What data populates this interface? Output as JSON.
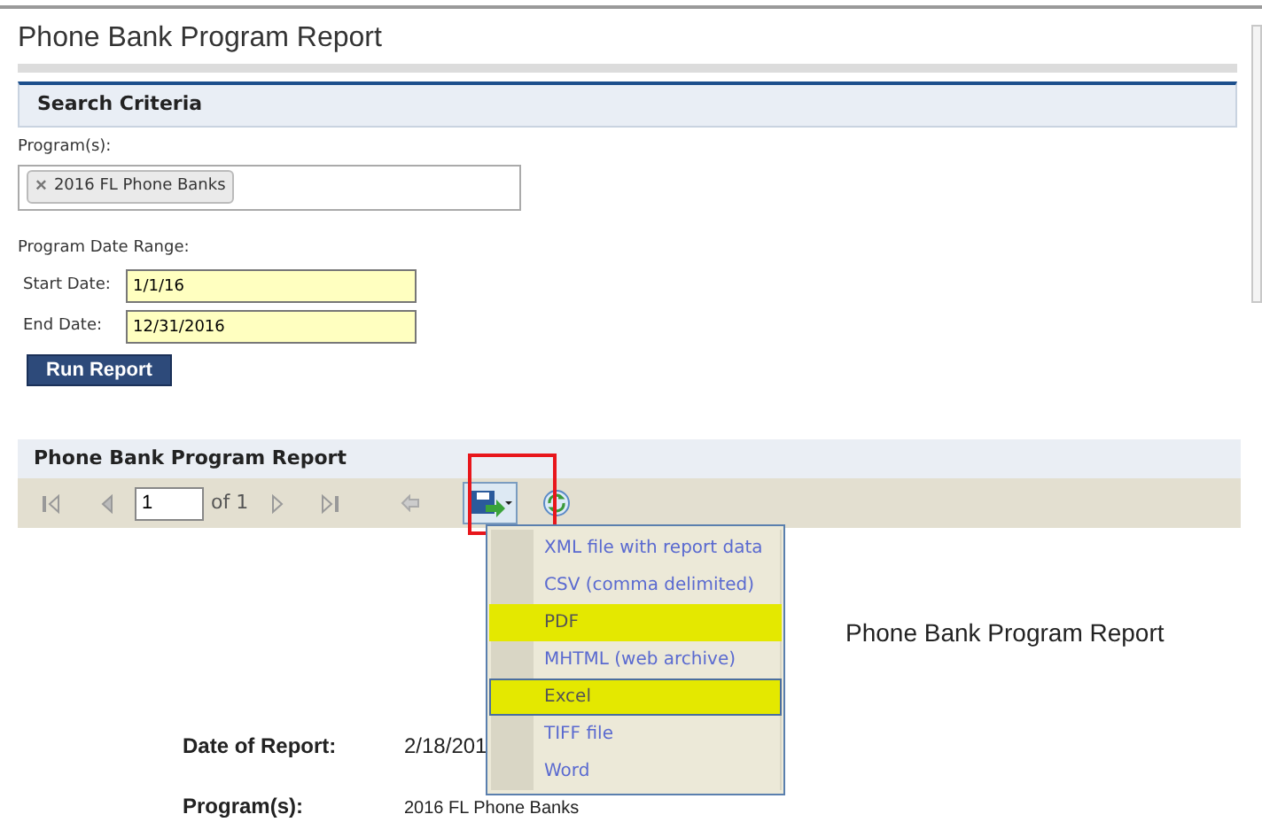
{
  "page_title": "Phone Bank Program Report",
  "search_criteria": {
    "title": "Search Criteria",
    "programs_label": "Program(s):",
    "programs": [
      {
        "label": "2016 FL Phone Banks",
        "remove": "×"
      }
    ],
    "date_range_label": "Program Date Range:",
    "start_date": {
      "label": "Start Date:",
      "value": "1/1/16"
    },
    "end_date": {
      "label": "End Date:",
      "value": "12/31/2016"
    },
    "run_button": "Run Report"
  },
  "report_viewer": {
    "title": "Phone Bank Program Report",
    "page_number": "1",
    "page_count": "of 1",
    "export_highlighted": true,
    "export_menu": [
      {
        "label": "XML file with report data",
        "highlighted": false,
        "selected": false
      },
      {
        "label": "CSV (comma delimited)",
        "highlighted": false,
        "selected": false
      },
      {
        "label": "PDF",
        "highlighted": true,
        "selected": false
      },
      {
        "label": "MHTML (web archive)",
        "highlighted": false,
        "selected": false
      },
      {
        "label": "Excel",
        "highlighted": true,
        "selected": true
      },
      {
        "label": "TIFF file",
        "highlighted": false,
        "selected": false
      },
      {
        "label": "Word",
        "highlighted": false,
        "selected": false
      }
    ]
  },
  "report": {
    "heading": "Phone Bank Program Report",
    "fields": [
      {
        "label": "Date of Report:",
        "value": "2/18/201"
      },
      {
        "label": "Program(s):",
        "value": "2016 FL Phone Banks"
      }
    ]
  }
}
